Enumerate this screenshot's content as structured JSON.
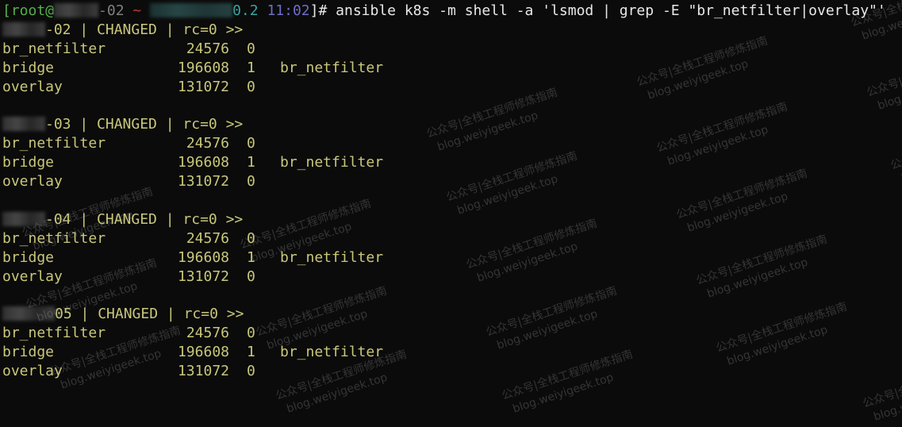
{
  "prompt": {
    "user": "[root@",
    "host_suffix": "-02",
    "tilde": "~",
    "ip_suffix": "0.2",
    "time": "11:02",
    "prompt_end": "]# ",
    "command": "ansible k8s -m shell -a 'lsmod | grep -E \"br_netfilter|overlay\"'"
  },
  "colors": {
    "text": "#c9c77c",
    "user": "#55b04a",
    "time": "#6e6cc8",
    "ip": "#3aa5a0",
    "tilde": "#c23a3a",
    "command": "#e8e8e8",
    "background": "#0b0b0b"
  },
  "hosts": [
    {
      "suffix": "-02",
      "status": " | CHANGED | rc=0 >>"
    },
    {
      "suffix": "-03",
      "status": " | CHANGED | rc=0 >>"
    },
    {
      "suffix": "-04",
      "status": " | CHANGED | rc=0 >>"
    },
    {
      "suffix": "05",
      "status": " | CHANGED | rc=0 >>"
    }
  ],
  "modules": [
    {
      "name": "br_netfilter",
      "size": "24576",
      "refs": "0",
      "used_by": ""
    },
    {
      "name": "bridge",
      "size": "196608",
      "refs": "1",
      "used_by": "br_netfilter"
    },
    {
      "name": "overlay",
      "size": "131072",
      "refs": "0",
      "used_by": ""
    }
  ],
  "watermark": {
    "line1": "公众号|全栈工程师修炼指南",
    "line2": "blog.weiyigeek.top"
  }
}
